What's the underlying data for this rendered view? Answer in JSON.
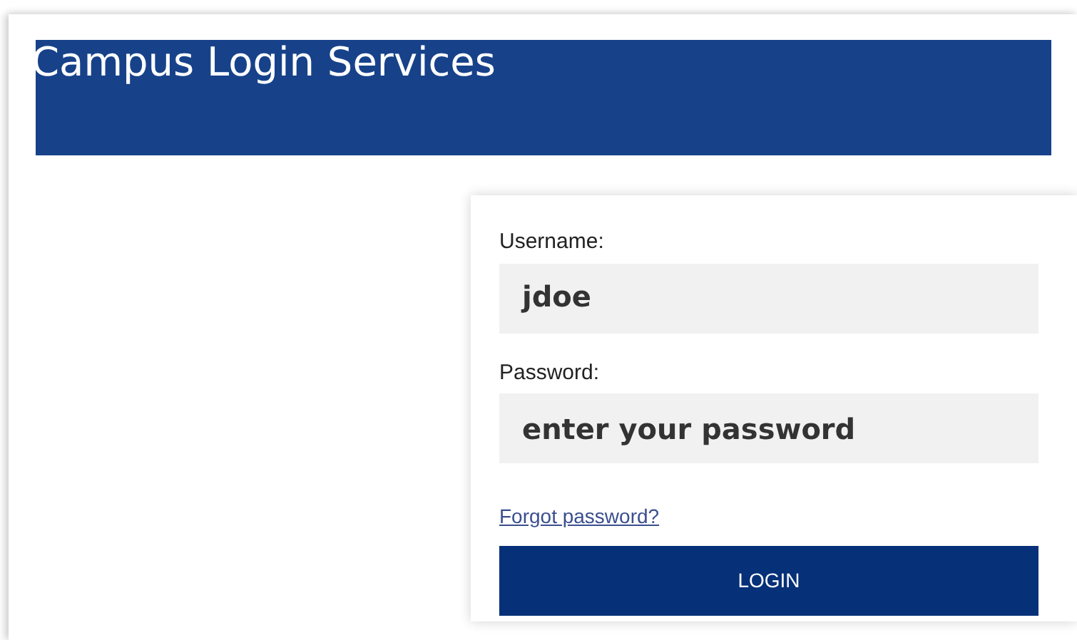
{
  "header": {
    "title": "Campus Login Services"
  },
  "form": {
    "fields": [
      {
        "label": "Username:",
        "value": "jdoe"
      },
      {
        "label": "Password:",
        "placeholder": "enter your password"
      }
    ],
    "link": "Forgot password?",
    "button": "LOGIN"
  }
}
